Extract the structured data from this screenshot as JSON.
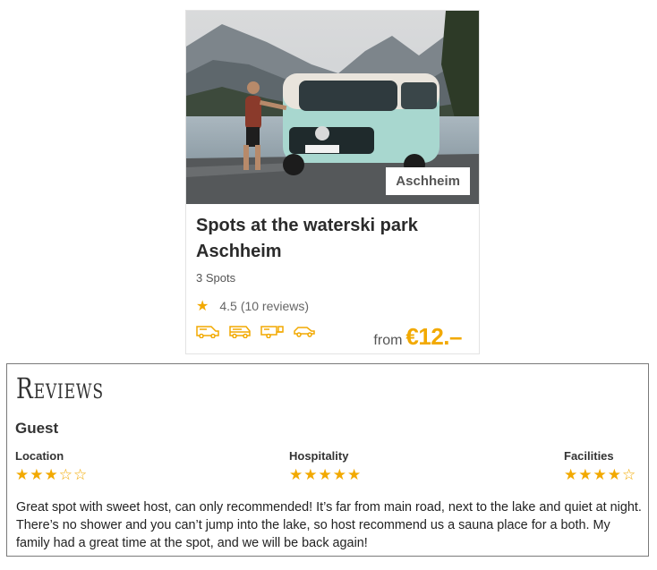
{
  "card": {
    "location_tag": "Aschheim",
    "title": "Spots at the waterski park Aschheim",
    "spots": "3 Spots",
    "rating_value": "4.5",
    "rating_reviews": "(10 reviews)",
    "vehicle_icons": [
      "motorhome-icon",
      "campervan-icon",
      "caravan-icon",
      "car-icon"
    ],
    "price_prefix": "from",
    "price": "€12.–",
    "accent_color": "#f2a900"
  },
  "reviews": {
    "heading": "Reviews",
    "reviewer": "Guest",
    "categories": [
      {
        "label": "Location",
        "stars": 3,
        "max": 5
      },
      {
        "label": "Hospitality",
        "stars": 5,
        "max": 5
      },
      {
        "label": "Facilities",
        "stars": 4,
        "max": 5
      }
    ],
    "text": "Great spot with sweet host, can only recommended! It’s far from main road, next to the lake and quiet at night. There’s no shower and you can’t jump into the lake, so host recommend us a sauna place for a both. My family had a great time at the spot, and we will be back again!"
  }
}
